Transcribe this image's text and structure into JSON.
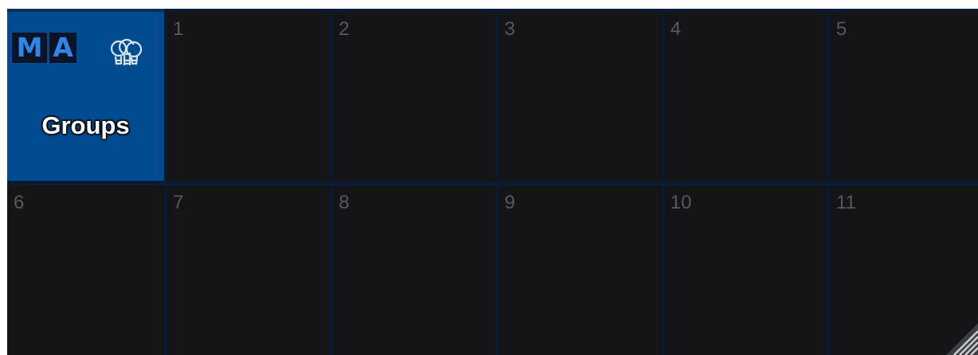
{
  "header": {
    "logo_m": "M",
    "logo_a": "A",
    "icon": "bulbs-icon",
    "title": "Groups"
  },
  "pool": {
    "tiles": [
      {
        "number": "1"
      },
      {
        "number": "2"
      },
      {
        "number": "3"
      },
      {
        "number": "4"
      },
      {
        "number": "5"
      },
      {
        "number": "6"
      },
      {
        "number": "7"
      },
      {
        "number": "8"
      },
      {
        "number": "9"
      },
      {
        "number": "10"
      },
      {
        "number": "11"
      }
    ]
  },
  "colors": {
    "header_bg": "#004b8f",
    "tile_bg": "#151517",
    "tile_number": "#56585c",
    "logo_text": "#2f86e6"
  },
  "resize_grip_icon": "resize-grip-icon"
}
